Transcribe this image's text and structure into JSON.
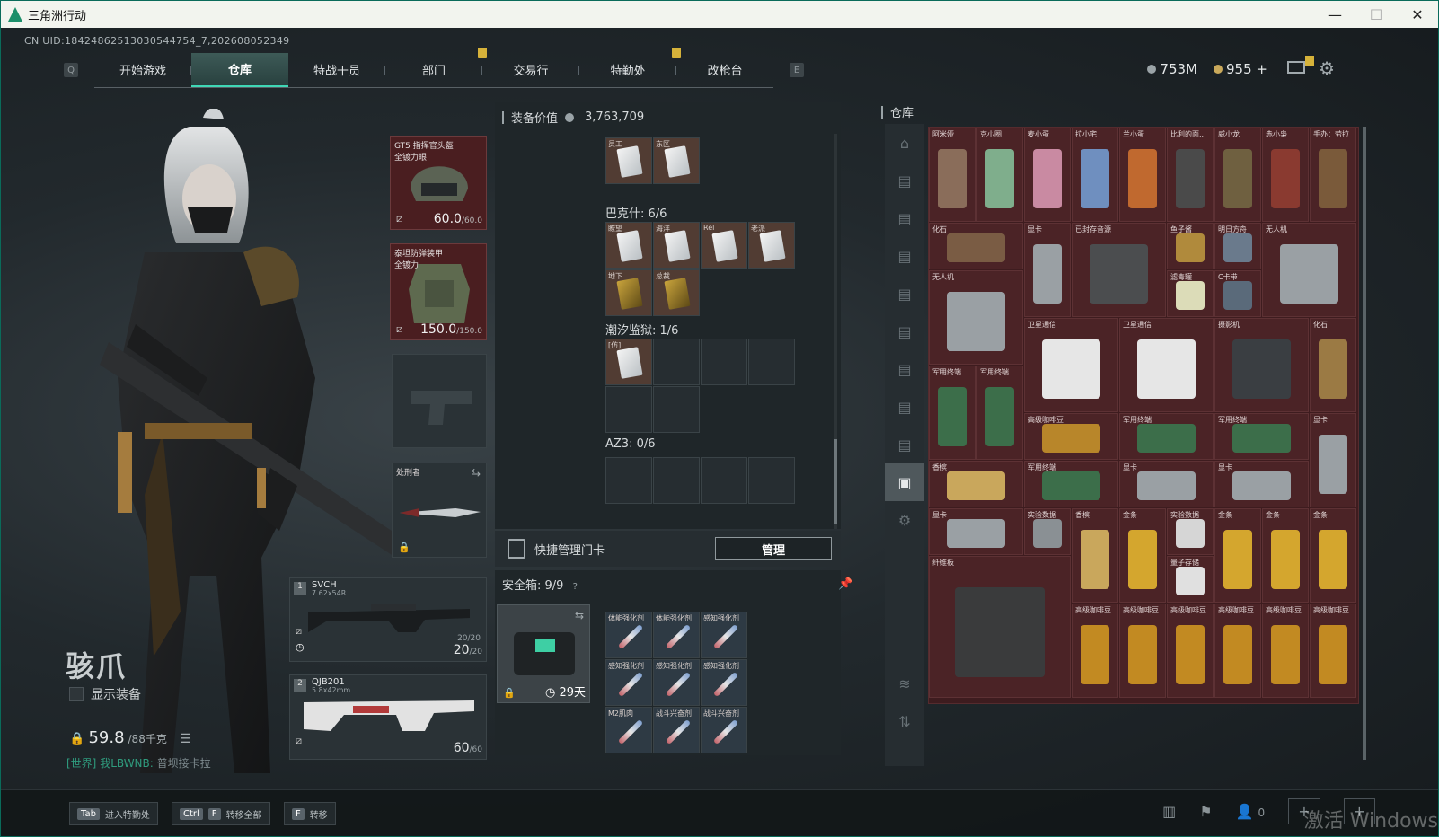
{
  "window": {
    "title": "三角洲行动"
  },
  "uid": "CN UID:18424862513030544754_7,202608052349",
  "nav": {
    "left_key": "Q",
    "right_key": "E",
    "tabs": [
      "开始游戏",
      "仓库",
      "特战干员",
      "部门",
      "交易行",
      "特勤处",
      "改枪台"
    ],
    "active_tab": 1
  },
  "currency": {
    "silver": "753M",
    "gold": "955"
  },
  "operator": {
    "name": "骇爪",
    "show_gear_label": "显示装备",
    "weight": "59.8",
    "weight_max": "/88千克"
  },
  "chat": {
    "channel": "[世界]",
    "user": "我LBWNB:",
    "message": "普坝接卡拉"
  },
  "slots": {
    "helmet": {
      "label": "GT5 指挥官头盔\n全镀力眼",
      "dur": "60.0",
      "max": "/60.0"
    },
    "armor": {
      "label": "泰坦防弹装甲\n全镀力",
      "dur": "150.0",
      "max": "/150.0"
    },
    "melee": {
      "label": "处刑者"
    },
    "weapon1": {
      "num": "1",
      "name": "SVCH",
      "cal": "7.62x54R",
      "ammo_small": "20/20",
      "ammo": "20",
      "ammo_max": "/20"
    },
    "weapon2": {
      "num": "2",
      "name": "QJB201",
      "cal": "5.8x42mm",
      "ammo": "60",
      "ammo_max": "/60"
    }
  },
  "middle": {
    "eq_value_label": "装备价值",
    "eq_value": "3,763,709",
    "sections": [
      {
        "title": "巴克什: 6/6"
      },
      {
        "title": "潮汐监狱: 1/6"
      },
      {
        "title": "AZ3: 0/6"
      }
    ],
    "row0_labels": [
      "员工",
      "东区"
    ],
    "bakesh_labels": [
      "瞭望",
      "海洋",
      "Rel",
      "老派",
      "地下",
      "总裁"
    ],
    "tide_labels": [
      "[仿]"
    ],
    "quick_label": "快捷管理门卡",
    "manage_btn": "管理",
    "safe_label": "安全箱:",
    "safe_count": "9/9",
    "safe_days": "29天",
    "safe_items": [
      "体能强化剂",
      "体能强化剂",
      "感知强化剂",
      "感知强化剂",
      "感知强化剂",
      "感知强化剂",
      "M2肌肉",
      "战斗兴奋剂",
      "战斗兴奋剂"
    ]
  },
  "warehouse": {
    "title": "仓库",
    "items": [
      {
        "label": "阿米娅"
      },
      {
        "label": "克小圈"
      },
      {
        "label": "麦小蛋"
      },
      {
        "label": "拉小宅"
      },
      {
        "label": "兰小蛋"
      },
      {
        "label": "比利的面..."
      },
      {
        "label": "威小龙"
      },
      {
        "label": "赤小枭"
      },
      {
        "label": "手办：劳拉"
      },
      {
        "label": "化石"
      },
      {
        "label": "显卡"
      },
      {
        "label": "已封存音源"
      },
      {
        "label": "鱼子酱"
      },
      {
        "label": "明日方舟"
      },
      {
        "label": "无人机"
      },
      {
        "label": "无人机"
      },
      {
        "label": "滤毒罐"
      },
      {
        "label": "C卡带"
      },
      {
        "label": "卫星通信"
      },
      {
        "label": "卫星通信"
      },
      {
        "label": "摄影机"
      },
      {
        "label": "化石"
      },
      {
        "label": "军用终端"
      },
      {
        "label": "军用终端"
      },
      {
        "label": "高级咖啡豆"
      },
      {
        "label": "军用终端"
      },
      {
        "label": "军用终端"
      },
      {
        "label": "显卡"
      },
      {
        "label": "香槟"
      },
      {
        "label": "军用终端"
      },
      {
        "label": "显卡"
      },
      {
        "label": "显卡"
      },
      {
        "label": "显卡"
      },
      {
        "label": "实验数据"
      },
      {
        "label": "香槟"
      },
      {
        "label": "金条"
      },
      {
        "label": "实验数据"
      },
      {
        "label": "金条"
      },
      {
        "label": "金条"
      },
      {
        "label": "金条"
      },
      {
        "label": "量子存储"
      },
      {
        "label": "纤维板"
      },
      {
        "label": "高级咖啡豆"
      },
      {
        "label": "高级咖啡豆"
      },
      {
        "label": "高级咖啡豆"
      },
      {
        "label": "高级咖啡豆"
      },
      {
        "label": "高级咖啡豆"
      },
      {
        "label": "高级咖啡豆"
      }
    ]
  },
  "bottom": {
    "keys": [
      {
        "k1": "Tab",
        "k2": "",
        "label": "进入特勤处"
      },
      {
        "k1": "Ctrl",
        "k2": "F",
        "label": "转移全部"
      },
      {
        "k1": "F",
        "k2": "",
        "label": "转移"
      }
    ],
    "friends": "0",
    "watermark": "激活 Windows"
  }
}
